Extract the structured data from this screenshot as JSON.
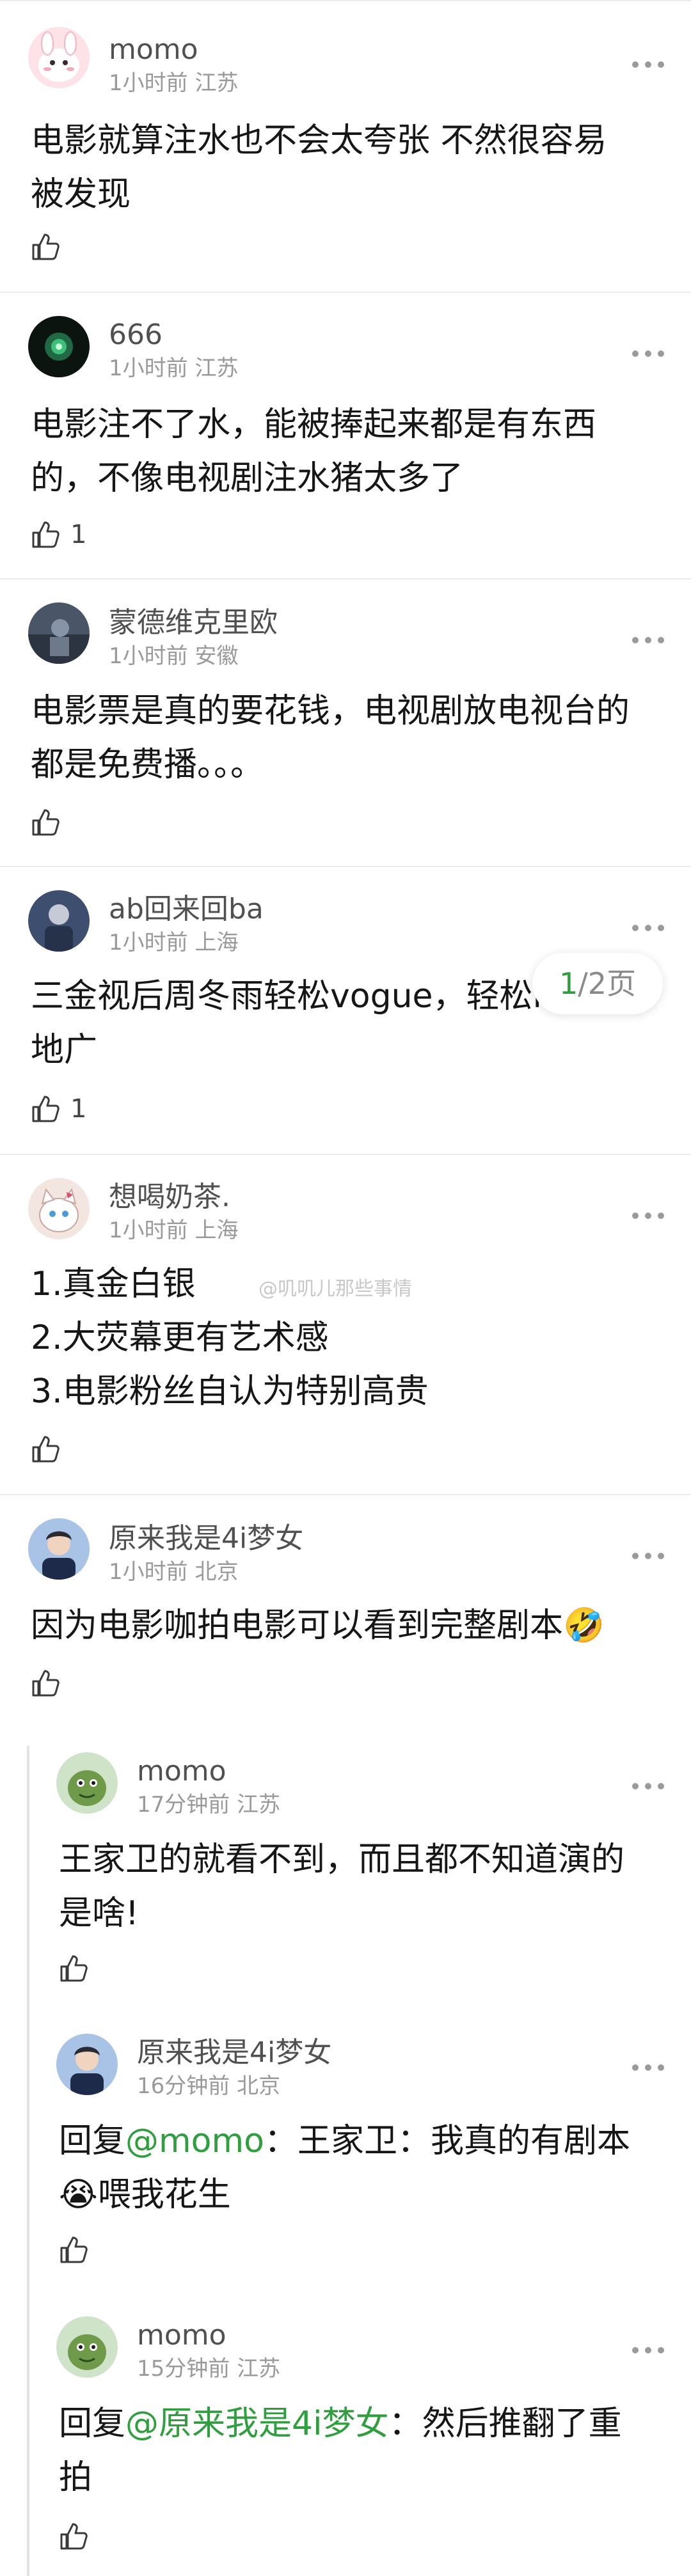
{
  "comments": [
    {
      "username": "momo",
      "time": "1小时前",
      "location": "江苏",
      "text_lines": [
        "电影就算注水也不会太夸张 不然很容易",
        "被发现"
      ],
      "likes": ""
    },
    {
      "username": "666",
      "time": "1小时前",
      "location": "江苏",
      "text_lines": [
        "电影注不了水，能被捧起来都是有东西",
        "的，不像电视剧注水猪太多了"
      ],
      "likes": "1"
    },
    {
      "username": "蒙德维克里欧",
      "time": "1小时前",
      "location": "安徽",
      "text_lines": [
        "电影票是真的要花钱，电视剧放电视台的",
        "都是免费播。。。"
      ],
      "likes": ""
    },
    {
      "username": "ab回来回ba",
      "time": "1小时前",
      "location": "上海",
      "text_lines": [
        "三金视后周冬雨轻松vogue，轻松lv全球",
        "地广"
      ],
      "likes": "1"
    },
    {
      "username": "想喝奶茶.",
      "time": "1小时前",
      "location": "上海",
      "text_lines": [
        "1.真金白银",
        "2.大荧幕更有艺术感",
        "3.电影粉丝自认为特别高贵"
      ],
      "likes": ""
    },
    {
      "username": "原来我是4i梦女",
      "time": "1小时前",
      "location": "北京",
      "text_lines": [
        "因为电影咖拍电影可以看到完整剧本🤣"
      ],
      "likes": ""
    }
  ],
  "replies": [
    {
      "username": "momo",
      "time": "17分钟前",
      "location": "江苏",
      "text_lines": [
        "王家卫的就看不到，而且都不知道演的",
        "是啥!"
      ],
      "likes": ""
    },
    {
      "username": "原来我是4i梦女",
      "time": "16分钟前",
      "location": "北京",
      "prefix": "回复",
      "mention": "@momo",
      "line1_rest": "：王家卫：我真的有剧本",
      "line2": "😭喂我花生",
      "likes": ""
    },
    {
      "username": "momo",
      "time": "15分钟前",
      "location": "江苏",
      "prefix": "回复",
      "mention": "@原来我是4i梦女",
      "line1_rest": "：然后推翻了重",
      "line2": "拍",
      "likes": ""
    }
  ],
  "pager": {
    "current": "1",
    "rest": "/2页"
  },
  "watermark": "@叽叽儿那些事情",
  "colors": {
    "mention": "#2f9e3f",
    "username": "#505050",
    "meta": "#9a9a9a",
    "divider": "#ececec"
  }
}
